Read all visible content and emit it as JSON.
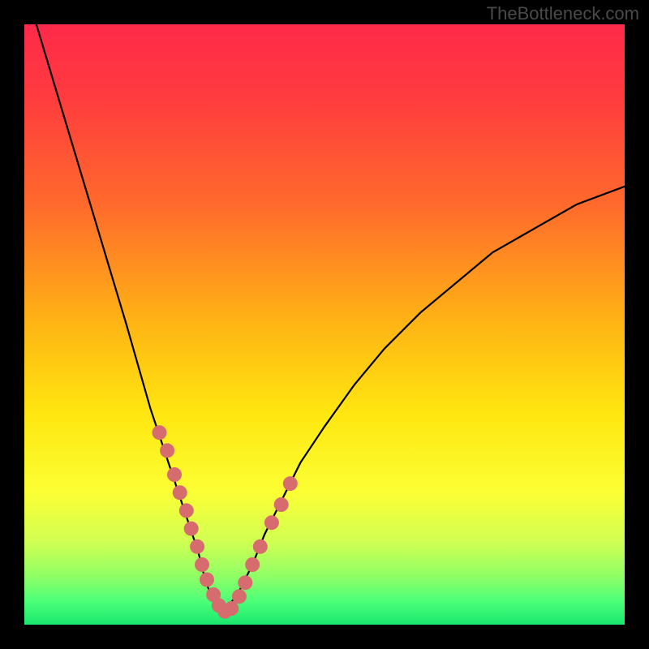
{
  "watermark": "TheBottleneck.com",
  "colors": {
    "background_black": "#000000",
    "curve_stroke": "#000000",
    "marker_fill": "#d76c6f",
    "gradient_stops": [
      {
        "offset": 0.0,
        "color": "#ff2a4a"
      },
      {
        "offset": 0.12,
        "color": "#ff3b3f"
      },
      {
        "offset": 0.3,
        "color": "#ff6a2c"
      },
      {
        "offset": 0.5,
        "color": "#ffb514"
      },
      {
        "offset": 0.65,
        "color": "#ffe710"
      },
      {
        "offset": 0.78,
        "color": "#fbff34"
      },
      {
        "offset": 0.86,
        "color": "#d2ff52"
      },
      {
        "offset": 0.92,
        "color": "#8fff66"
      },
      {
        "offset": 0.96,
        "color": "#4eff78"
      },
      {
        "offset": 1.0,
        "color": "#19e86f"
      }
    ]
  },
  "chart_data": {
    "type": "line",
    "title": "",
    "xlabel": "",
    "ylabel": "",
    "xlim": [
      0,
      100
    ],
    "ylim": [
      0,
      100
    ],
    "legend": false,
    "grid": false,
    "series": [
      {
        "name": "bottleneck-curve",
        "x": [
          2,
          5,
          8,
          11,
          14,
          17,
          19,
          21,
          23,
          25,
          27,
          29,
          30,
          31,
          32,
          33,
          34,
          36,
          38,
          40,
          43,
          46,
          50,
          55,
          60,
          66,
          72,
          78,
          85,
          92,
          100
        ],
        "y": [
          100,
          90,
          80,
          70,
          60,
          50,
          43,
          36,
          30,
          24,
          18,
          12,
          8,
          5,
          3,
          2,
          3,
          6,
          10,
          15,
          21,
          27,
          33,
          40,
          46,
          52,
          57,
          62,
          66,
          70,
          73
        ]
      }
    ],
    "markers": {
      "name": "highlight-points",
      "x": [
        22.5,
        23.8,
        25.0,
        25.9,
        27.0,
        27.8,
        28.8,
        29.6,
        30.4,
        31.5,
        32.4,
        33.4,
        34.5,
        35.8,
        36.8,
        38.0,
        39.3,
        41.2,
        42.8,
        44.3
      ],
      "y": [
        32,
        29,
        25,
        22,
        19,
        16,
        13,
        10,
        7.5,
        5,
        3.2,
        2.2,
        2.7,
        4.7,
        7,
        10,
        13,
        17,
        20,
        23.5
      ]
    }
  }
}
